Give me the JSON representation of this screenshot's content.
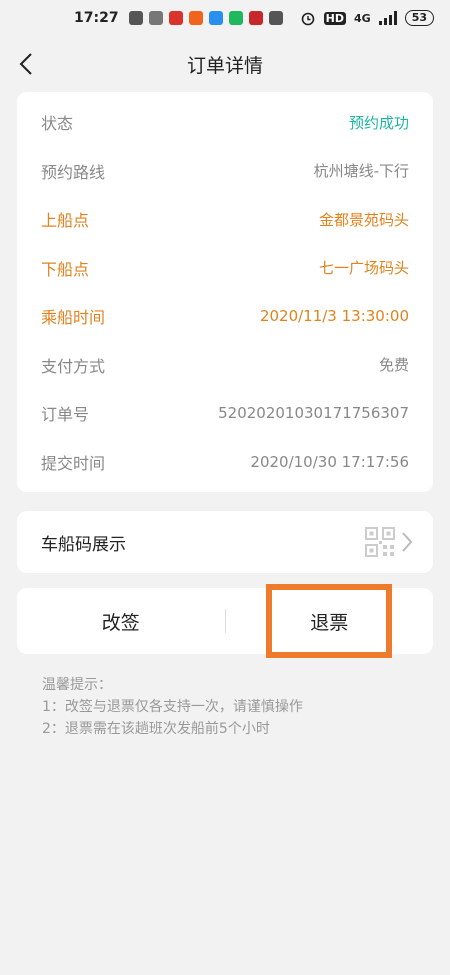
{
  "status_bar": {
    "time": "17:27",
    "network": "4G",
    "hd": "HD",
    "battery": "53"
  },
  "header": {
    "title": "订单详情"
  },
  "order": {
    "rows": [
      {
        "label": "状态",
        "value": "预约成功"
      },
      {
        "label": "预约路线",
        "value": "杭州塘线-下行"
      },
      {
        "label": "上船点",
        "value": "金都景苑码头"
      },
      {
        "label": "下船点",
        "value": "七一广场码头"
      },
      {
        "label": "乘船时间",
        "value": "2020/11/3 13:30:00"
      },
      {
        "label": "支付方式",
        "value": "免费"
      },
      {
        "label": "订单号",
        "value": "52020201030171756307"
      },
      {
        "label": "提交时间",
        "value": "2020/10/30 17:17:56"
      }
    ]
  },
  "qr": {
    "label": "车船码展示",
    "icon": "qr-code-icon"
  },
  "actions": {
    "change_label": "改签",
    "refund_label": "退票"
  },
  "tips": {
    "title": "温馨提示：",
    "line1": "1：改签与退票仅各支持一次，请谨慎操作",
    "line2": "2：退票需在该趟班次发船前5个小时"
  },
  "colors": {
    "accent_orange": "#e0831f",
    "success_teal": "#21b5a0",
    "highlight": "#ee7a2c"
  }
}
